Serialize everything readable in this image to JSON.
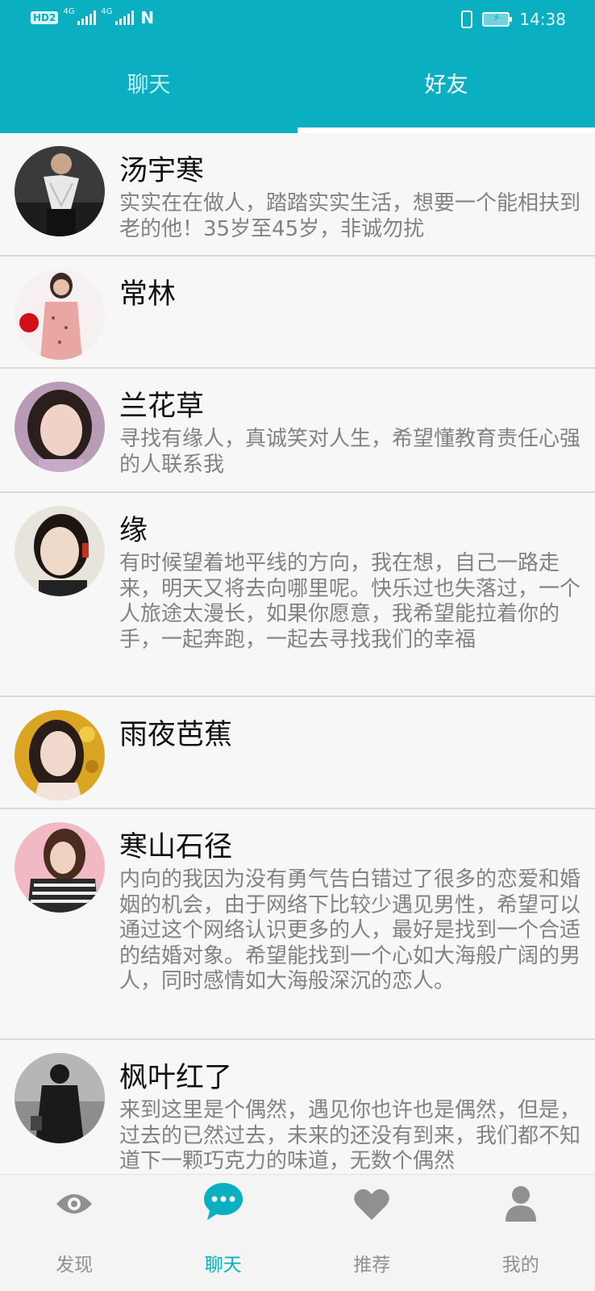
{
  "status_bar": {
    "hd_label": "HD",
    "sim_index": "2",
    "network_1": "4G",
    "network_2": "4G",
    "nfc": "N",
    "time": "14:38"
  },
  "tabs": [
    {
      "label": "聊天",
      "active": false
    },
    {
      "label": "好友",
      "active": true
    }
  ],
  "friends": [
    {
      "name": "汤宇寒",
      "description": "实实在在做人，踏踏实实生活，想要一个能相扶到老的他！35岁至45岁，非诚勿扰"
    },
    {
      "name": "常林",
      "description": ""
    },
    {
      "name": "兰花草",
      "description": "寻找有缘人，真诚笑对人生，希望懂教育责任心强的人联系我"
    },
    {
      "name": "缘",
      "description": "有时候望着地平线的方向，我在想，自己一路走来，明天又将去向哪里呢。快乐过也失落过，一个人旅途太漫长，如果你愿意，我希望能拉着你的手，一起奔跑，一起去寻找我们的幸福"
    },
    {
      "name": "雨夜芭蕉",
      "description": ""
    },
    {
      "name": "寒山石径",
      "description": "内向的我因为没有勇气告白错过了很多的恋爱和婚姻的机会，由于网络下比较少遇见男性，希望可以通过这个网络认识更多的人，最好是找到一个合适的结婚对象。希望能找到一个心如大海般广阔的男人，同时感情如大海般深沉的恋人。"
    },
    {
      "name": "枫叶红了",
      "description": "来到这里是个偶然，遇见你也许也是偶然，但是，过去的已然过去，未来的还没有到来，我们都不知道下一颗巧克力的味道，无数个偶然"
    }
  ],
  "bottom_nav": [
    {
      "label": "发现",
      "icon": "eye-icon",
      "active": false
    },
    {
      "label": "聊天",
      "icon": "chat-bubble-icon",
      "active": true
    },
    {
      "label": "推荐",
      "icon": "heart-icon",
      "active": false
    },
    {
      "label": "我的",
      "icon": "person-icon",
      "active": false
    }
  ],
  "colors": {
    "primary": "#0aafc1",
    "inactive": "#909090",
    "background": "#f7f7f7"
  }
}
